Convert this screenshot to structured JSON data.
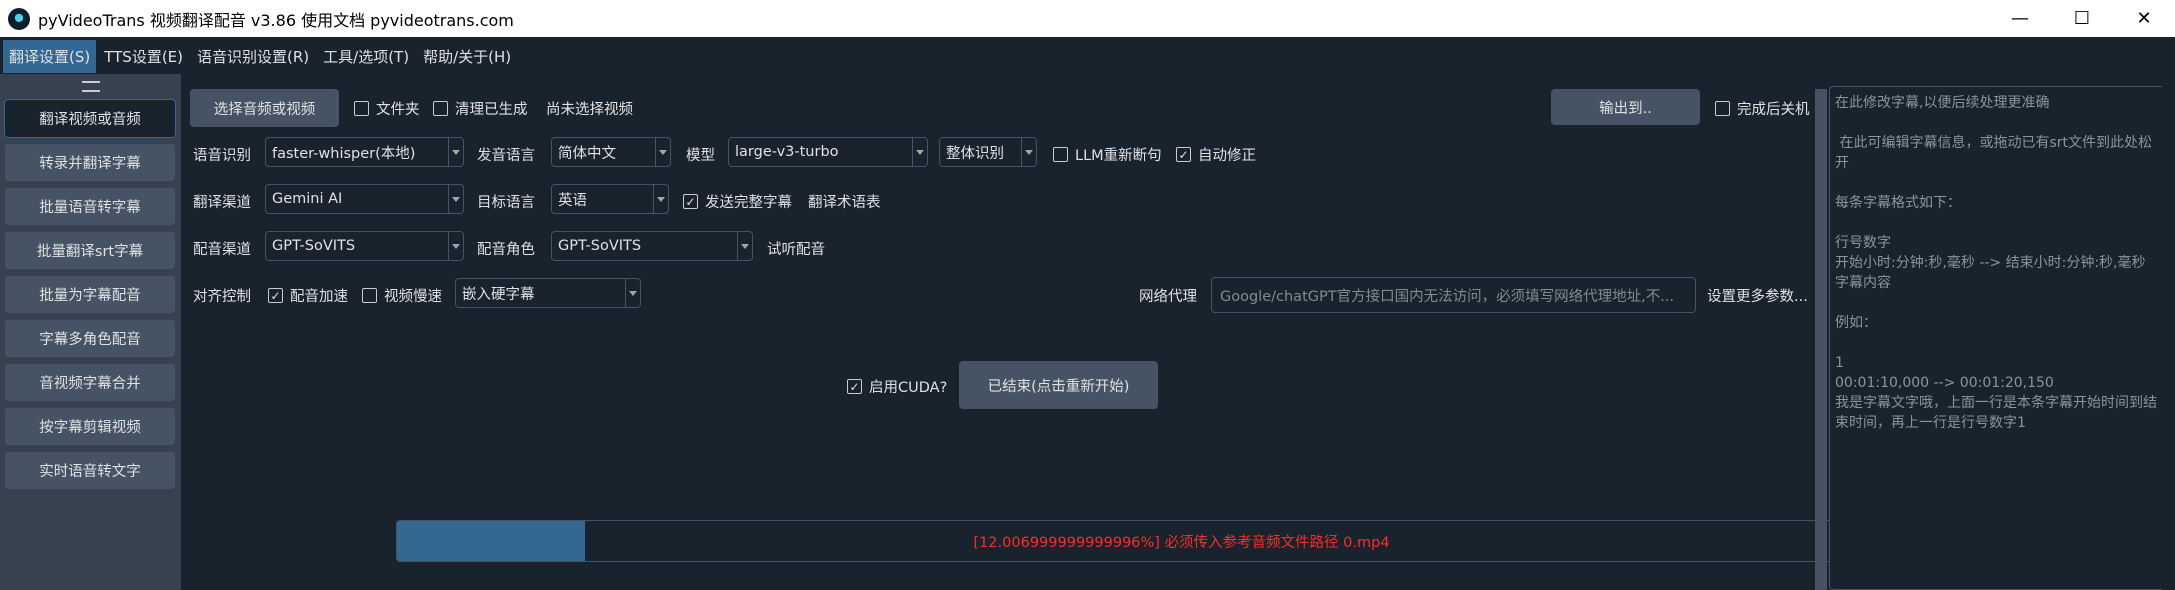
{
  "window": {
    "title": "pyVideoTrans 视频翻译配音 v3.86 使用文档 pyvideotrans.com"
  },
  "menu": [
    "翻译设置(S)",
    "TTS设置(E)",
    "语音识别设置(R)",
    "工具/选项(T)",
    "帮助/关于(H)"
  ],
  "sidebar": {
    "items": [
      "翻译视频或音频",
      "转录并翻译字幕",
      "批量语音转字幕",
      "批量翻译srt字幕",
      "批量为字幕配音",
      "字幕多角色配音",
      "音视频字幕合并",
      "按字幕剪辑视频",
      "实时语音转文字"
    ]
  },
  "row1": {
    "select_button": "选择音频或视频",
    "folder_label": "文件夹",
    "clean_label": "清理已生成",
    "no_video_text": "尚未选择视频",
    "output_button": "输出到..",
    "shutdown_label": "完成后关机"
  },
  "row2": {
    "asr_label": "语音识别",
    "asr_value": "faster-whisper(本地)",
    "lang_label": "发音语言",
    "lang_value": "简体中文",
    "model_label": "模型",
    "model_value": "large-v3-turbo",
    "mode_value": "整体识别",
    "llm_label": "LLM重新断句",
    "autofix_label": "自动修正"
  },
  "row3": {
    "channel_label": "翻译渠道",
    "channel_value": "Gemini AI",
    "target_label": "目标语言",
    "target_value": "英语",
    "send_full_label": "发送完整字幕",
    "glossary_label": "翻译术语表"
  },
  "row4": {
    "dub_channel_label": "配音渠道",
    "dub_channel_value": "GPT-SoVITS",
    "role_label": "配音角色",
    "role_value": "GPT-SoVITS",
    "listen_label": "试听配音"
  },
  "row5": {
    "align_label": "对齐控制",
    "dub_speed_label": "配音加速",
    "video_slow_label": "视频慢速",
    "subtitle_mode_value": "嵌入硬字幕",
    "proxy_label": "网络代理",
    "proxy_placeholder": "Google/chatGPT官方接口国内无法访问，必须填写网络代理地址,不...",
    "more_settings": "设置更多参数..."
  },
  "run": {
    "cuda_label": "启用CUDA?",
    "status_button": "已结束(点击重新开始)"
  },
  "progress": {
    "fraction": 0.12,
    "text": "[12.006999999999996%]  必须传入参考音频文件路径   0.mp4"
  },
  "subtitle_editor": {
    "placeholder": "在此修改字幕,以便后续处理更准确\n\n 在此可编辑字幕信息，或拖动已有srt文件到此处松开\n\n每条字幕格式如下：\n\n行号数字\n开始小时:分钟:秒,毫秒 --> 结束小时:分钟:秒,毫秒\n字幕内容\n\n例如：\n\n1\n00:01:10,000 --> 00:01:20,150\n我是字幕文字哦，上面一行是本条字幕开始时间到结束时间，再上一行是行号数字1"
  },
  "colors": {
    "accent": "#346792",
    "error": "#ff2a2a",
    "background": "#19232d",
    "button": "#455364"
  }
}
